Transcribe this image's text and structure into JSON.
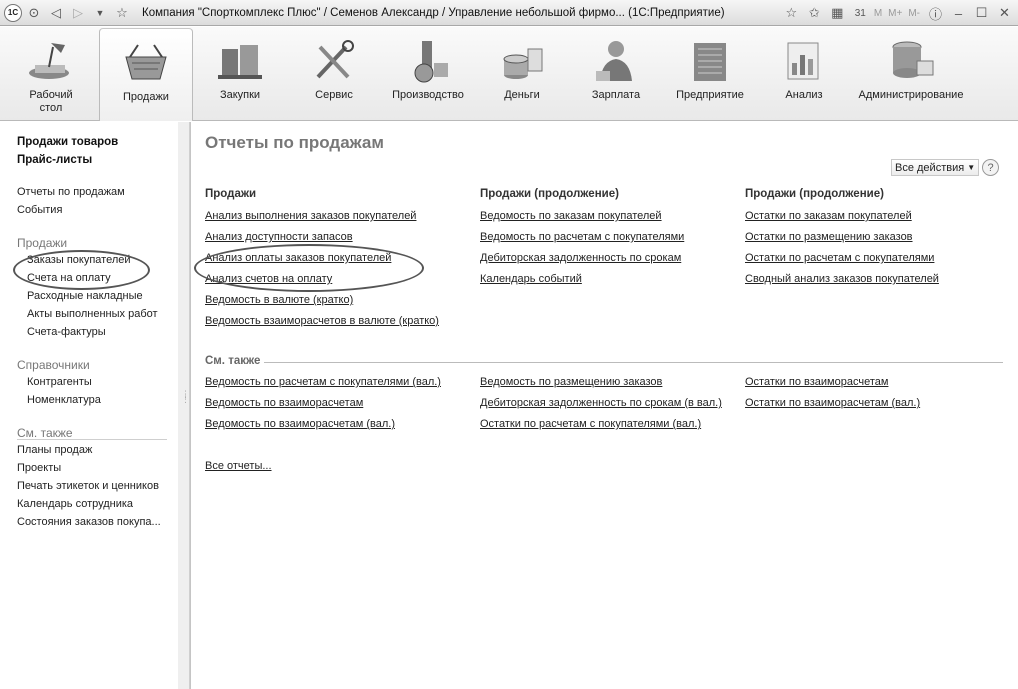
{
  "window": {
    "logo": "1С",
    "title": "Компания \"Спорткомплекс Плюс\" / Семенов Александр / Управление небольшой фирмо... (1С:Предприятие)",
    "memory_buttons": [
      "M",
      "M+",
      "M-"
    ]
  },
  "sections": [
    {
      "label": "Рабочий стол",
      "icon": "desk-lamp-icon"
    },
    {
      "label": "Продажи",
      "icon": "shopping-basket-icon",
      "active": true
    },
    {
      "label": "Закупки",
      "icon": "warehouse-icon"
    },
    {
      "label": "Сервис",
      "icon": "tools-icon"
    },
    {
      "label": "Производство",
      "icon": "factory-icon"
    },
    {
      "label": "Деньги",
      "icon": "coins-icon"
    },
    {
      "label": "Зарплата",
      "icon": "employee-icon"
    },
    {
      "label": "Предприятие",
      "icon": "building-icon"
    },
    {
      "label": "Анализ",
      "icon": "chart-icon"
    },
    {
      "label": "Администрирование",
      "icon": "server-icon"
    }
  ],
  "leftnav": {
    "top_links": [
      "Продажи товаров",
      "Прайс-листы"
    ],
    "links": [
      "Отчеты по продажам",
      "События"
    ],
    "sales_group": "Продажи",
    "sales_items": [
      "Заказы покупателей",
      "Счета на оплату",
      "Расходные накладные",
      "Акты выполненных работ",
      "Счета-фактуры"
    ],
    "ref_group": "Справочники",
    "ref_items": [
      "Контрагенты",
      "Номенклатура"
    ],
    "also_group": "См. также",
    "also_items": [
      "Планы продаж",
      "Проекты",
      "Печать этикеток и ценников",
      "Календарь сотрудника",
      "Состояния заказов покупа..."
    ]
  },
  "main": {
    "title": "Отчеты по продажам",
    "all_actions": "Все действия",
    "help": "?",
    "columns": [
      {
        "header": "Продажи",
        "links": [
          "Анализ выполнения заказов покупателей",
          "Анализ доступности запасов",
          "Анализ оплаты заказов покупателей",
          "Анализ счетов на оплату",
          "Ведомость в валюте (кратко)",
          "Ведомость взаиморасчетов в валюте (кратко)"
        ]
      },
      {
        "header": "Продажи (продолжение)",
        "links": [
          "Ведомость по заказам покупателей",
          "Ведомость по расчетам с покупателями",
          "Дебиторская задолженность по срокам",
          "Календарь событий"
        ]
      },
      {
        "header": "Продажи (продолжение)",
        "links": [
          "Остатки по заказам покупателей",
          "Остатки по размещению заказов",
          "Остатки по расчетам с покупателями",
          "Сводный анализ заказов покупателей"
        ]
      }
    ],
    "see_also_title": "См. также",
    "see_also": [
      [
        "Ведомость  по расчетам с покупателями (вал.)",
        "Ведомость по взаиморасчетам",
        "Ведомость по взаиморасчетам (вал.)"
      ],
      [
        "Ведомость по размещению заказов",
        "Дебиторская задолженность по срокам (в вал.)",
        "Остатки  по расчетам с покупателями (вал.)"
      ],
      [
        "Остатки по взаиморасчетам",
        "Остатки по взаиморасчетам (вал.)"
      ]
    ],
    "all_reports": "Все отчеты..."
  }
}
